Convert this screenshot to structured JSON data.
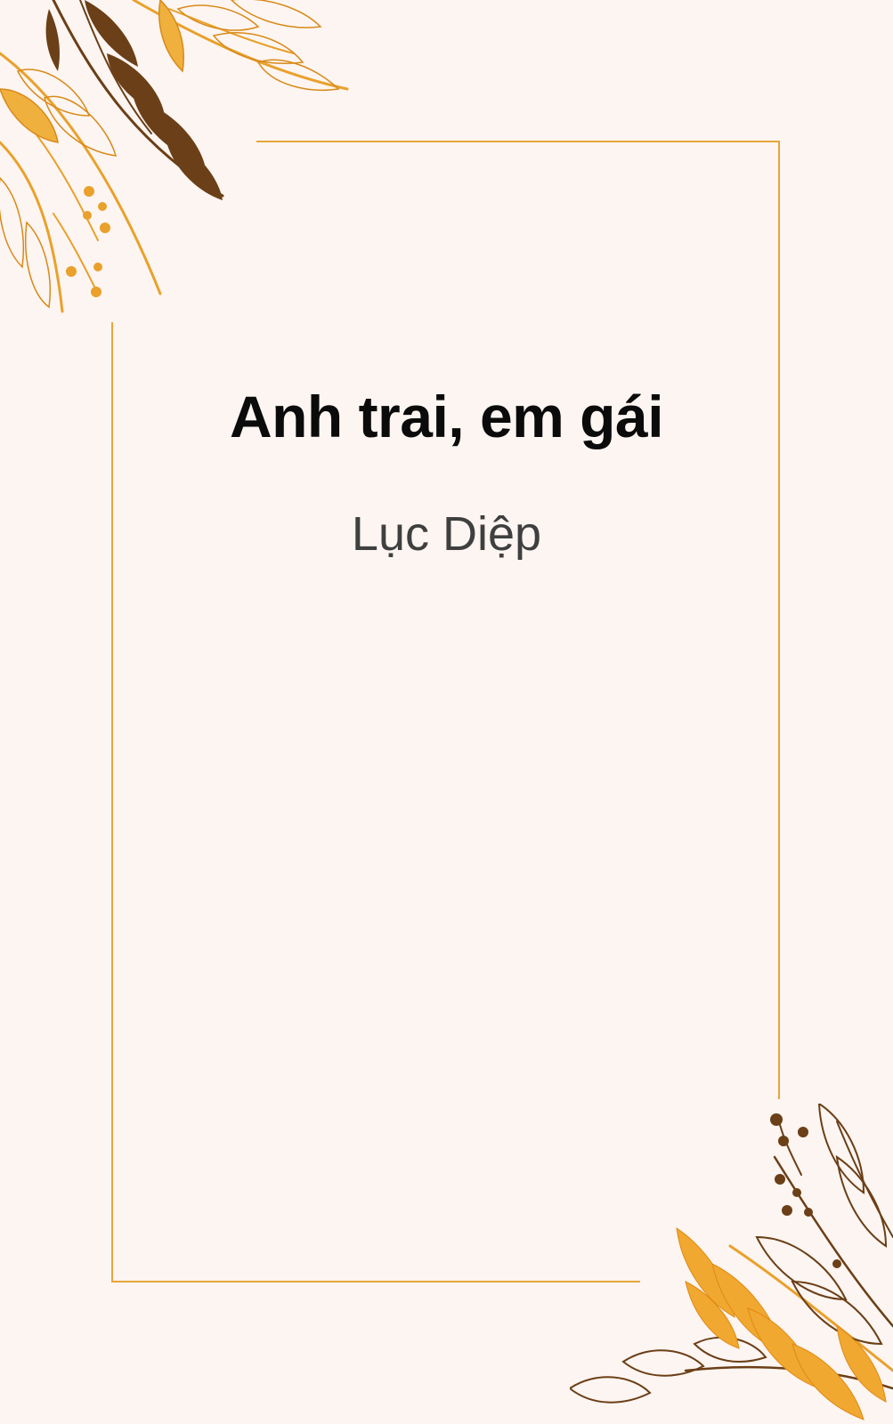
{
  "cover": {
    "title": "Anh trai, em gái",
    "author": "Lục Diệp"
  },
  "colors": {
    "background": "#fcf5f1",
    "frame": "#e6a63a",
    "gold_leaf": "#e9a12c",
    "brown_leaf": "#6b3f17",
    "title_text": "#0b0b0b",
    "author_text": "#3f3f3f"
  },
  "decorations": [
    "leaf-branch-top-left",
    "leaf-branch-bottom-right"
  ]
}
